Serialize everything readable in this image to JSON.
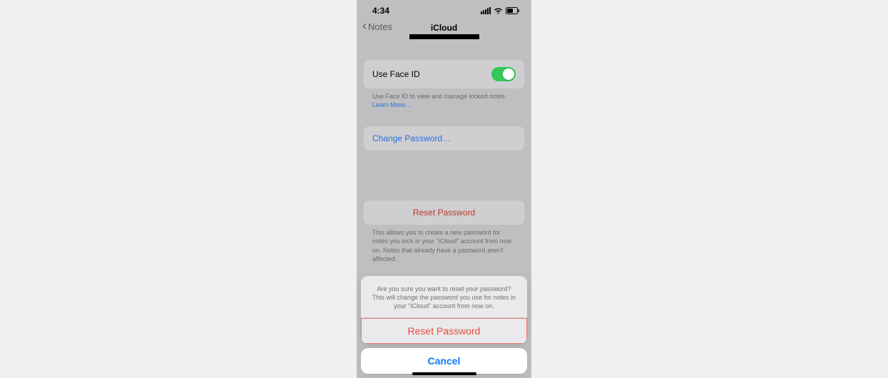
{
  "status": {
    "time": "4:34"
  },
  "nav": {
    "back_label": "Notes",
    "title": "iCloud"
  },
  "rows": {
    "face_id_label": "Use Face ID",
    "face_id_on": true,
    "face_id_footer_pre": "Use Face ID to view and manage locked notes. ",
    "face_id_footer_link": "Learn More…",
    "change_password_label": "Change Password…",
    "reset_password_label": "Reset Password",
    "reset_password_footer": "This allows you to create a new password for notes you lock in your \"iCloud\" account from now on. Notes that already have a password aren't affected."
  },
  "sheet": {
    "message": "Are you sure you want to reset your password? This will change the password you use for notes in your \"iCloud\" account from now on.",
    "action_label": "Reset Password",
    "cancel_label": "Cancel"
  }
}
